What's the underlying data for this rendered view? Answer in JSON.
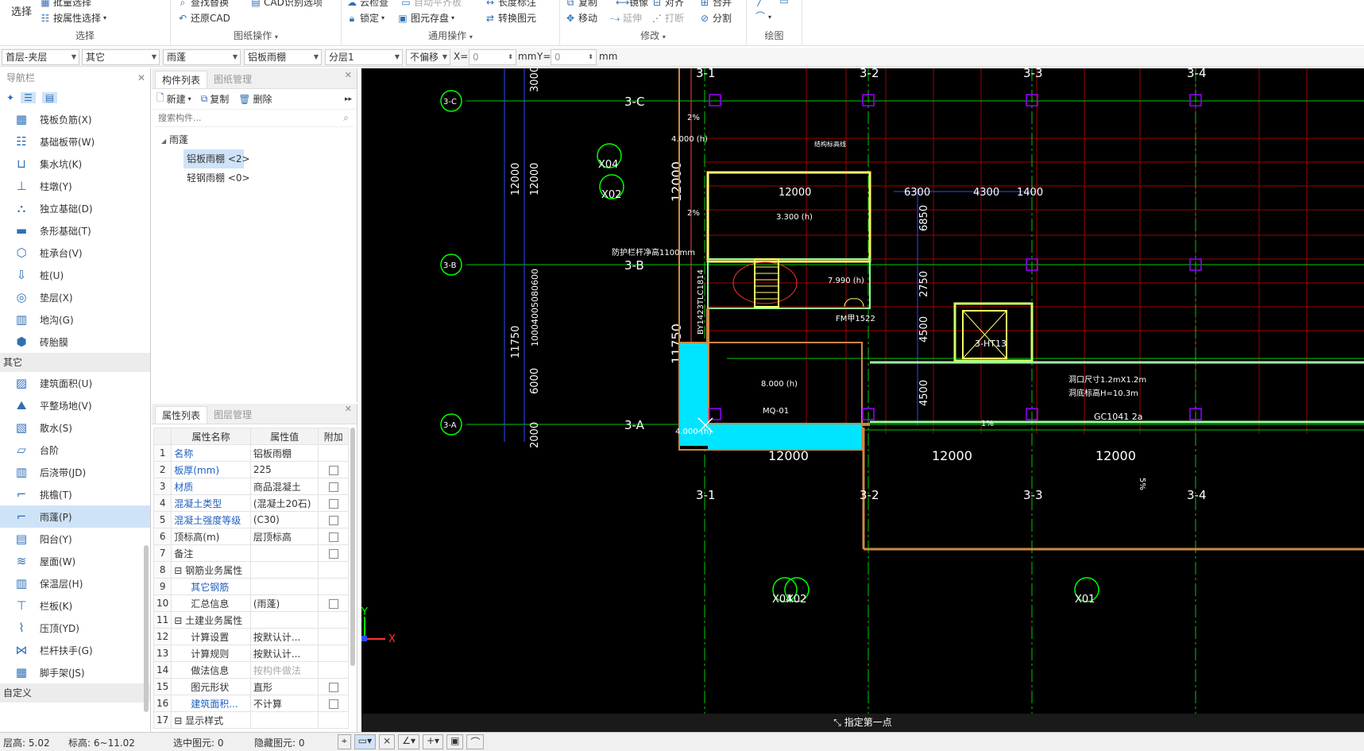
{
  "ribbon": {
    "select_group": {
      "title": "选择",
      "big_label": "选择",
      "batch_select": "批量选择",
      "attr_select": "按属性选择"
    },
    "drawing_group": {
      "title": "图纸操作",
      "find_replace": "查找替换",
      "restore_cad": "还原CAD",
      "cad_recognize": "CAD识别选项"
    },
    "common_group": {
      "title": "通用操作",
      "cloud_check": "云检查",
      "lock": "锁定",
      "element_save": "图元存盘",
      "convert_element": "转换图元",
      "auto_floor": "自动平齐板",
      "length_mark": "长度标注"
    },
    "modify_group": {
      "title": "修改",
      "copy": "复制",
      "mirror": "镜像",
      "align": "对齐",
      "merge": "合并",
      "move": "移动",
      "extend": "延伸",
      "break": "打断",
      "split": "分割"
    },
    "draw_group": {
      "title": "绘图"
    }
  },
  "toolbar": {
    "floor": "首层-夹层",
    "category": "其它",
    "type": "雨蓬",
    "subtype": "铝板雨棚",
    "layer": "分层1",
    "offset": "不偏移",
    "x_label": "X=",
    "x_value": "0",
    "mm1": "mm",
    "y_label": "Y=",
    "y_value": "0",
    "mm2": "mm"
  },
  "nav": {
    "title": "导航栏",
    "group1": [
      {
        "label": "筏板负筋(X)",
        "icon": "raft-rebar-icon"
      },
      {
        "label": "基础板带(W)",
        "icon": "foundation-strip-icon"
      },
      {
        "label": "集水坑(K)",
        "icon": "sump-icon"
      },
      {
        "label": "柱墩(Y)",
        "icon": "column-pier-icon"
      },
      {
        "label": "独立基础(D)",
        "icon": "isolated-footing-icon"
      },
      {
        "label": "条形基础(T)",
        "icon": "strip-footing-icon"
      },
      {
        "label": "桩承台(V)",
        "icon": "pile-cap-icon"
      },
      {
        "label": "桩(U)",
        "icon": "pile-icon"
      },
      {
        "label": "垫层(X)",
        "icon": "cushion-icon"
      },
      {
        "label": "地沟(G)",
        "icon": "trench-icon"
      },
      {
        "label": "砖胎膜",
        "icon": "brick-mold-icon"
      }
    ],
    "section_other": "其它",
    "group2": [
      {
        "label": "建筑面积(U)",
        "icon": "building-area-icon"
      },
      {
        "label": "平整场地(V)",
        "icon": "site-leveling-icon"
      },
      {
        "label": "散水(S)",
        "icon": "apron-icon"
      },
      {
        "label": "台阶",
        "icon": "steps-icon"
      },
      {
        "label": "后浇带(JD)",
        "icon": "post-pour-icon"
      },
      {
        "label": "挑檐(T)",
        "icon": "cornice-icon"
      },
      {
        "label": "雨蓬(P)",
        "icon": "canopy-icon"
      },
      {
        "label": "阳台(Y)",
        "icon": "balcony-icon"
      },
      {
        "label": "屋面(W)",
        "icon": "roof-icon"
      },
      {
        "label": "保温层(H)",
        "icon": "insulation-icon"
      },
      {
        "label": "栏板(K)",
        "icon": "parapet-icon"
      },
      {
        "label": "压顶(YD)",
        "icon": "coping-icon"
      },
      {
        "label": "栏杆扶手(G)",
        "icon": "railing-icon"
      },
      {
        "label": "脚手架(JS)",
        "icon": "scaffold-icon"
      }
    ],
    "section_custom": "自定义"
  },
  "comp": {
    "tab1": "构件列表",
    "tab2": "图纸管理",
    "new": "新建",
    "copy": "复制",
    "delete": "删除",
    "search_placeholder": "搜索构件...",
    "root": "雨蓬",
    "child1": "铝板雨棚 <2>",
    "child2": "轻钢雨棚 <0>"
  },
  "prop": {
    "tab1": "属性列表",
    "tab2": "图层管理",
    "headers": [
      "属性名称",
      "属性值",
      "附加"
    ],
    "rows": [
      {
        "n": "1",
        "k": "名称",
        "v": "铝板雨棚",
        "blue": true,
        "cb": false
      },
      {
        "n": "2",
        "k": "板厚(mm)",
        "v": "225",
        "blue": true,
        "cb": true
      },
      {
        "n": "3",
        "k": "材质",
        "v": "商品混凝土",
        "blue": true,
        "cb": true
      },
      {
        "n": "4",
        "k": "混凝土类型",
        "v": "(混凝土20石)",
        "blue": true,
        "cb": true
      },
      {
        "n": "5",
        "k": "混凝土强度等级",
        "v": "(C30)",
        "blue": true,
        "cb": true
      },
      {
        "n": "6",
        "k": "顶标高(m)",
        "v": "层顶标高",
        "blue": false,
        "cb": true
      },
      {
        "n": "7",
        "k": "备注",
        "v": "",
        "blue": false,
        "cb": true
      },
      {
        "n": "8",
        "k": "钢筋业务属性",
        "v": "",
        "blue": false,
        "cb": false,
        "group": true
      },
      {
        "n": "9",
        "k": "其它钢筋",
        "v": "",
        "blue": true,
        "cb": false,
        "indent": true
      },
      {
        "n": "10",
        "k": "汇总信息",
        "v": "(雨蓬)",
        "blue": false,
        "cb": true,
        "indent": true
      },
      {
        "n": "11",
        "k": "土建业务属性",
        "v": "",
        "blue": false,
        "cb": false,
        "group": true
      },
      {
        "n": "12",
        "k": "计算设置",
        "v": "按默认计...",
        "blue": false,
        "cb": false,
        "indent": true
      },
      {
        "n": "13",
        "k": "计算规则",
        "v": "按默认计...",
        "blue": false,
        "cb": false,
        "indent": true
      },
      {
        "n": "14",
        "k": "做法信息",
        "v": "按构件做法",
        "blue": false,
        "cb": false,
        "indent": true,
        "muted": true
      },
      {
        "n": "15",
        "k": "图元形状",
        "v": "直形",
        "blue": false,
        "cb": true,
        "indent": true
      },
      {
        "n": "16",
        "k": "建筑面积...",
        "v": "不计算",
        "blue": true,
        "cb": true,
        "indent": true
      },
      {
        "n": "17",
        "k": "显示样式",
        "v": "",
        "blue": false,
        "cb": false,
        "group": true
      }
    ]
  },
  "canvas": {
    "axis_top": [
      "3-1",
      "3-2",
      "3-3",
      "3-4"
    ],
    "axis_left": [
      "3-C",
      "3-B",
      "3-A"
    ],
    "dims_bottom": [
      "12000",
      "12000",
      "12000"
    ],
    "dims_top": [
      "12000",
      "6300",
      "4300",
      "1400"
    ],
    "dims_vert": [
      "12000",
      "11750",
      "6850",
      "2750",
      "4500",
      "4500",
      "3000",
      "12000",
      "12000",
      "11750",
      "6000",
      "2000",
      "10004005080600"
    ],
    "elevations": [
      "4.000 (h)",
      "3.300 (h)",
      "7.990 (h)",
      "8.000 (h)",
      "4.000 (h)"
    ],
    "labels": [
      "X04",
      "X02",
      "X01",
      "3-HT13",
      "FM甲1522",
      "MQ-01",
      "GC1041 2a",
      "BY1423TLC1814",
      "防护栏杆净高1100mm",
      "洞口尺寸1.2mX1.2m",
      "洞底标高H=10.3m",
      "结构标高线",
      "2%",
      "1%",
      "5%"
    ],
    "command_prompt": "指定第一点",
    "ucs_x": "X",
    "ucs_y": "Y"
  },
  "status": {
    "floor_height": "层高:",
    "fh_val": "5.02",
    "elevation": "标高:",
    "el_val": "6~11.02",
    "selected": "选中图元:",
    "sel_val": "0",
    "hidden": "隐藏图元:",
    "hid_val": "0"
  },
  "colors": {
    "canvas_bg": "#000000",
    "axis_green": "#00ff00",
    "cyan_fill": "#00e5ff",
    "yellow": "#ffff66",
    "red_grid": "#b00000",
    "accent_blue": "#2f6fb5"
  }
}
